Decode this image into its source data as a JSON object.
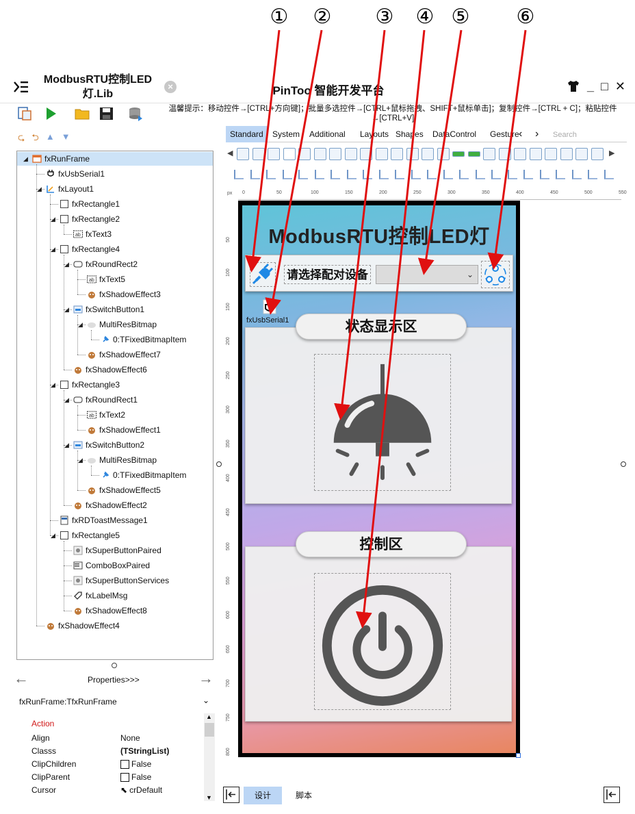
{
  "markers": [
    "①",
    "②",
    "③",
    "④",
    "⑤",
    "⑥"
  ],
  "titlebar": {
    "file_tab": "ModbusRTU控制LED灯.Lib",
    "close_glyph": "×",
    "app_title": "PinToo 智能开发平台",
    "min_glyph": "_",
    "max_glyph": "□",
    "close_window_glyph": "✕"
  },
  "toolbar": {
    "hint": "温馨提示：移动控件→[CTRL+方向键]；批量多选控件→[CTRL+鼠标拖拽、SHIFT+鼠标单击]；复制控件→[CTRL + C]；粘贴控件→[CTRL+V]"
  },
  "tree": {
    "nodes": [
      {
        "label": "fxRunFrame",
        "icon": "frame-icon",
        "level": 0
      },
      {
        "label": "fxUsbSerial1",
        "icon": "usb-plug-icon",
        "level": 1
      },
      {
        "label": "fxLayout1",
        "icon": "layout-icon",
        "level": 1
      },
      {
        "label": "fxRectangle1",
        "icon": "rectangle-icon",
        "level": 2
      },
      {
        "label": "fxRectangle2",
        "icon": "rectangle-icon",
        "level": 2
      },
      {
        "label": "fxText3",
        "icon": "text-icon",
        "level": 3
      },
      {
        "label": "fxRectangle4",
        "icon": "rectangle-icon",
        "level": 2
      },
      {
        "label": "fxRoundRect2",
        "icon": "roundrect-icon",
        "level": 3
      },
      {
        "label": "fxText5",
        "icon": "text-icon",
        "level": 4
      },
      {
        "label": "fxShadowEffect3",
        "icon": "shadow-effect-icon",
        "level": 4
      },
      {
        "label": "fxSwitchButton1",
        "icon": "switch-button-icon",
        "level": 3
      },
      {
        "label": "MultiResBitmap",
        "icon": "bitmap-icon",
        "level": 4
      },
      {
        "label": "0:TFixedBitmapItem",
        "icon": "pin-icon",
        "level": 5
      },
      {
        "label": "fxShadowEffect7",
        "icon": "shadow-effect-icon",
        "level": 4
      },
      {
        "label": "fxShadowEffect6",
        "icon": "shadow-effect-icon",
        "level": 3
      },
      {
        "label": "fxRectangle3",
        "icon": "rectangle-icon",
        "level": 2
      },
      {
        "label": "fxRoundRect1",
        "icon": "roundrect-icon",
        "level": 3
      },
      {
        "label": "fxText2",
        "icon": "text-icon",
        "level": 4
      },
      {
        "label": "fxShadowEffect1",
        "icon": "shadow-effect-icon",
        "level": 4
      },
      {
        "label": "fxSwitchButton2",
        "icon": "switch-button-icon",
        "level": 3
      },
      {
        "label": "MultiResBitmap",
        "icon": "bitmap-icon",
        "level": 4
      },
      {
        "label": "0:TFixedBitmapItem",
        "icon": "pin-icon",
        "level": 5
      },
      {
        "label": "fxShadowEffect5",
        "icon": "shadow-effect-icon",
        "level": 4
      },
      {
        "label": "fxShadowEffect2",
        "icon": "shadow-effect-icon",
        "level": 3
      },
      {
        "label": "fxRDToastMessage1",
        "icon": "toast-icon",
        "level": 2
      },
      {
        "label": "fxRectangle5",
        "icon": "rectangle-icon",
        "level": 2
      },
      {
        "label": "fxSuperButtonPaired",
        "icon": "super-button-icon",
        "level": 3
      },
      {
        "label": "ComboBoxPaired",
        "icon": "combobox-icon",
        "level": 3
      },
      {
        "label": "fxSuperButtonServices",
        "icon": "super-button-icon",
        "level": 3
      },
      {
        "label": "fxLabelMsg",
        "icon": "label-icon",
        "level": 3
      },
      {
        "label": "fxShadowEffect8",
        "icon": "shadow-effect-icon",
        "level": 3
      },
      {
        "label": "fxShadowEffect4",
        "icon": "shadow-effect-icon",
        "level": 1
      }
    ]
  },
  "properties": {
    "nav_label": "Properties>>>",
    "object": "fxRunFrame:TfxRunFrame",
    "category": "Action",
    "rows": [
      {
        "key": "Align",
        "value": "None",
        "bold": false,
        "checkbox": false
      },
      {
        "key": "Classs",
        "value": "(TStringList)",
        "bold": true,
        "checkbox": false
      },
      {
        "key": "ClipChildren",
        "value": "False",
        "bold": false,
        "checkbox": true
      },
      {
        "key": "ClipParent",
        "value": "False",
        "bold": false,
        "checkbox": true
      },
      {
        "key": "Cursor",
        "value": "crDefault",
        "bold": false,
        "checkbox": false
      }
    ]
  },
  "palette": {
    "tabs": [
      "Standard",
      "System",
      "Additional",
      "Layouts",
      "Shapes",
      "DataControl",
      "Gesture"
    ],
    "active_tab": "Standard",
    "search_placeholder": "Search"
  },
  "ruler": {
    "unit": "px",
    "top_ticks": [
      "0",
      "50",
      "100",
      "150",
      "200",
      "250",
      "300",
      "350",
      "400",
      "450",
      "500",
      "550"
    ],
    "left_ticks": [
      "50",
      "100",
      "150",
      "200",
      "250",
      "300",
      "350",
      "400",
      "450",
      "500",
      "550",
      "600",
      "650",
      "700",
      "750",
      "800"
    ]
  },
  "canvas": {
    "heading": "ModbusRTU控制LED灯",
    "pair_label": "请选择配对设备",
    "combo_value": "",
    "usb_component_label": "fxUsbSerial1",
    "status_title": "状态显示区",
    "control_title": "控制区"
  },
  "bottom": {
    "design_tab": "设计",
    "script_tab": "脚本"
  },
  "colors": {
    "annotation_arrow": "#e01010",
    "accent_blue": "#2e86de",
    "selection": "#cde3f7"
  }
}
